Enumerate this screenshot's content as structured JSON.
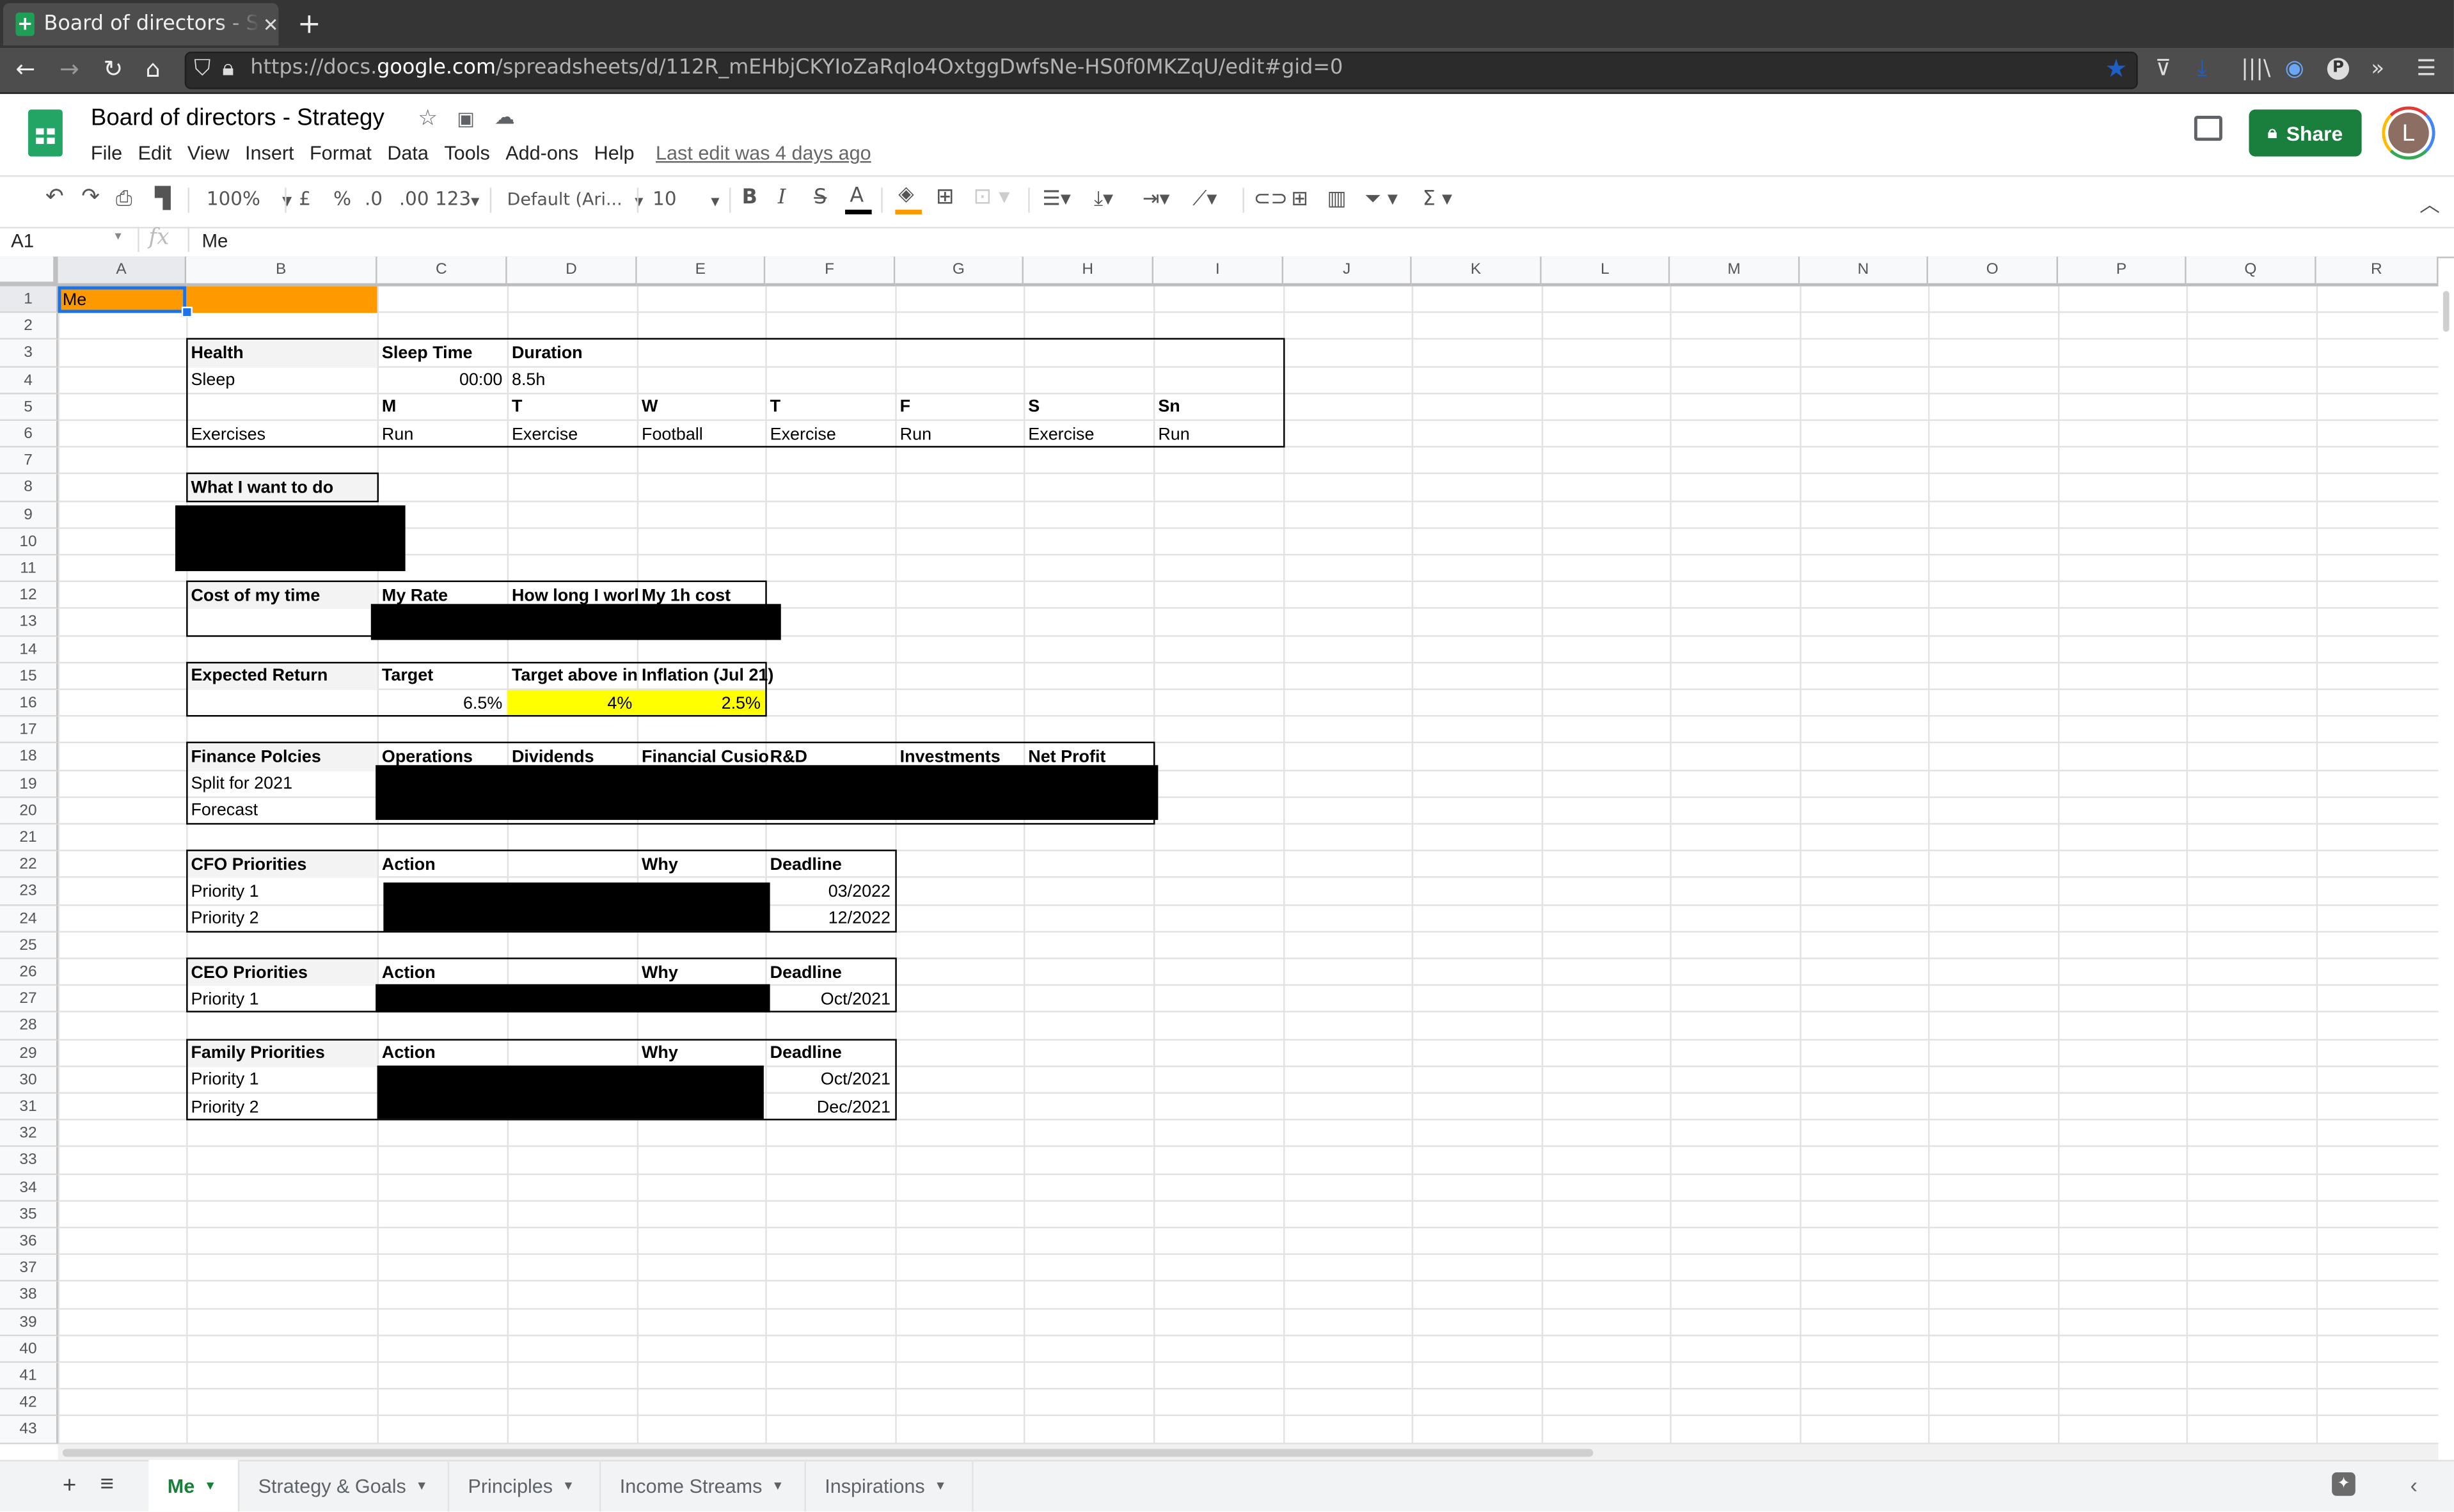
{
  "browser": {
    "tab_title": "Board of directors - Strategy",
    "new_tab": "+",
    "url_prefix": "https://docs.",
    "url_domain": "google.com",
    "url_path": "/spreadsheets/d/112R_mEHbjCKYIoZaRqlo4OxtggDwfsNe-HS0f0MKZqU/edit#gid=0",
    "icons": [
      "back-icon",
      "forward-icon",
      "reload-icon",
      "home-icon",
      "shield-icon",
      "lock-icon",
      "bookmark-star-icon",
      "pocket-icon",
      "download-icon",
      "library-icon",
      "extension-icon",
      "profile-p-icon",
      "overflow-icon",
      "hamburger-menu-icon"
    ]
  },
  "header": {
    "doc_title": "Board of directors - Strategy",
    "menu": [
      "File",
      "Edit",
      "View",
      "Insert",
      "Format",
      "Data",
      "Tools",
      "Add-ons",
      "Help"
    ],
    "last_edit": "Last edit was 4 days ago",
    "share_label": "Share",
    "avatar_initial": "L"
  },
  "toolbar": {
    "zoom": "100%",
    "currency": "£",
    "percent": "%",
    "dec_decrease": ".0",
    "dec_increase": ".00",
    "more_formats": "123",
    "font": "Default (Ari...",
    "font_size": "10",
    "bold": "B",
    "italic": "I",
    "strike": "S",
    "text_color_label": "A",
    "text_color": "#000000",
    "fill_color": "#ff9900"
  },
  "formula_bar": {
    "name_box": "A1",
    "fx": "fx",
    "value": "Me"
  },
  "grid": {
    "columns": [
      "A",
      "B",
      "C",
      "D",
      "E",
      "F",
      "G",
      "H",
      "I",
      "J",
      "K",
      "L",
      "M",
      "N",
      "O",
      "P",
      "Q",
      "R"
    ],
    "rows": [
      "1",
      "2",
      "3",
      "4",
      "5",
      "6",
      "7",
      "8",
      "9",
      "10",
      "11",
      "12",
      "13",
      "14",
      "15",
      "16",
      "17",
      "18",
      "19",
      "20",
      "21",
      "22",
      "23",
      "24",
      "25",
      "26",
      "27",
      "28",
      "29",
      "30",
      "31",
      "32",
      "33",
      "34",
      "35",
      "36",
      "37",
      "38",
      "39",
      "40",
      "41",
      "42",
      "43"
    ],
    "selected_cell": "A1",
    "highlight_color": "#ff9900",
    "yellow": "#ffff00"
  },
  "cells": {
    "a1": "Me",
    "health": {
      "title": "Health",
      "sleep_time_hdr": "Sleep Time",
      "duration_hdr": "Duration",
      "sleep_label": "Sleep",
      "sleep_time": "00:00",
      "duration": "8.5h",
      "days": [
        "M",
        "T",
        "W",
        "T",
        "F",
        "S",
        "Sn"
      ],
      "exercises_label": "Exercises",
      "exercises": [
        "Run",
        "Exercise",
        "Football",
        "Exercise",
        "Run",
        "Exercise",
        "Run"
      ]
    },
    "want": {
      "title": "What I want to do"
    },
    "cost": {
      "title": "Cost of my time",
      "rate": "My Rate",
      "how_long": "How long I worl",
      "hour_cost": "My 1h cost"
    },
    "expected": {
      "title": "Expected Return",
      "target": "Target",
      "target_above": "Target above in",
      "inflation": "Inflation (Jul 21)",
      "target_val": "6.5%",
      "above_val": "4%",
      "inflation_val": "2.5%"
    },
    "finance": {
      "title": "Finance Polcies",
      "headers": [
        "Operations",
        "Dividends",
        "Financial Cusio",
        "R&D",
        "Investments",
        "Net Profit"
      ],
      "rows": [
        "Split for 2021",
        "Forecast"
      ]
    },
    "cfo": {
      "title": "CFO Priorities",
      "action": "Action",
      "why": "Why",
      "deadline": "Deadline",
      "rows": [
        {
          "label": "Priority 1",
          "deadline": "03/2022"
        },
        {
          "label": "Priority 2",
          "deadline": "12/2022"
        }
      ]
    },
    "ceo": {
      "title": "CEO Priorities",
      "action": "Action",
      "why": "Why",
      "deadline": "Deadline",
      "rows": [
        {
          "label": "Priority 1",
          "deadline": "Oct/2021"
        }
      ]
    },
    "family": {
      "title": "Family Priorities",
      "action": "Action",
      "why": "Why",
      "deadline": "Deadline",
      "rows": [
        {
          "label": "Priority 1",
          "deadline": "Oct/2021"
        },
        {
          "label": "Priority 2",
          "deadline": "Dec/2021"
        }
      ]
    }
  },
  "sheets": {
    "add": "+",
    "list": "≡",
    "tabs": [
      {
        "label": "Me",
        "active": true
      },
      {
        "label": "Strategy & Goals",
        "active": false
      },
      {
        "label": "Principles",
        "active": false
      },
      {
        "label": "Income Streams",
        "active": false
      },
      {
        "label": "Inspirations",
        "active": false
      }
    ]
  }
}
